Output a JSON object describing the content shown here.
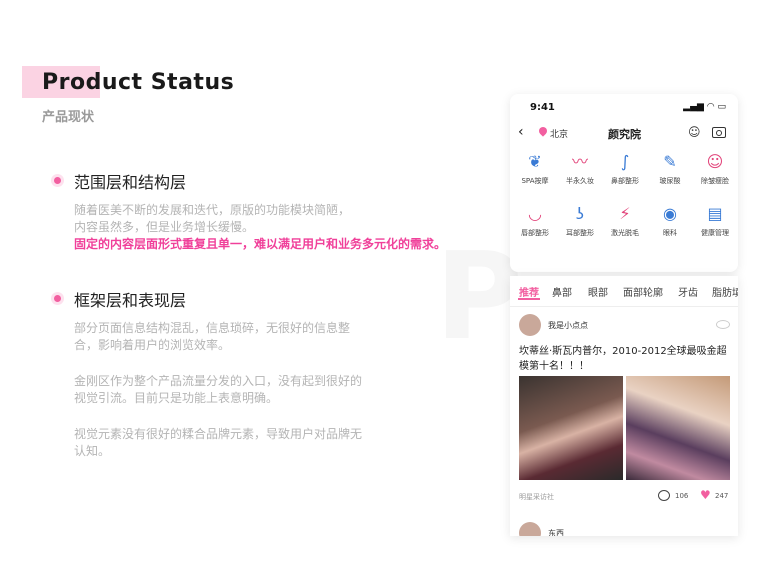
{
  "header": {
    "title": "Product Status",
    "subtitle": "产品现状"
  },
  "watermark": "P",
  "sections": [
    {
      "title": "范围层和结构层",
      "paragraphs": [
        {
          "lines": [
            "随着医美不断的发展和迭代，原版的功能模块简陋，",
            "内容虽然多，但是业务增长缓慢。"
          ]
        },
        {
          "lines": [
            "固定的内容层面形式重复且单一，难以满足用户和业务多元化的需求。"
          ],
          "highlight": true
        }
      ]
    },
    {
      "title": "框架层和表现层",
      "paragraphs": [
        {
          "lines": [
            "部分页面信息结构混乱，信息琐碎，无很好的信息整",
            "合，影响着用户的浏览效率。"
          ]
        },
        {
          "lines": [
            "金刚区作为整个产品流量分发的入口，没有起到很好的",
            "视觉引流。目前只是功能上表意明确。"
          ]
        },
        {
          "lines": [
            "视觉元素没有很好的糅合品牌元素，导致用户对品牌无",
            "认知。"
          ]
        }
      ]
    }
  ],
  "phone": {
    "status_time": "9:41",
    "status_icons": "▂▄▆ ◠ ▭",
    "nav": {
      "back_icon": "‹",
      "location": "北京",
      "title": "颜究院"
    },
    "grid": [
      {
        "icon": "spa-icon",
        "glyph": "❦",
        "label": "SPA按摩",
        "color": "#3a7bd5"
      },
      {
        "icon": "eyebrow-icon",
        "glyph": "〰",
        "label": "半永久妆",
        "color": "#e2457b"
      },
      {
        "icon": "nose-icon",
        "glyph": "∫",
        "label": "鼻部整形",
        "color": "#3a7bd5"
      },
      {
        "icon": "syringe-icon",
        "glyph": "✎",
        "label": "玻尿酸",
        "color": "#3a7bd5"
      },
      {
        "icon": "face-icon",
        "glyph": "☺",
        "label": "除皱瘦脸",
        "color": "#e2457b"
      },
      {
        "icon": "lips-icon",
        "glyph": "◡",
        "label": "唇部整形",
        "color": "#e2457b"
      },
      {
        "icon": "ear-icon",
        "glyph": "ʖ",
        "label": "耳部整形",
        "color": "#3a7bd5"
      },
      {
        "icon": "laser-icon",
        "glyph": "⚡",
        "label": "激光脱毛",
        "color": "#e2457b"
      },
      {
        "icon": "eye-icon",
        "glyph": "◉",
        "label": "眼科",
        "color": "#3a7bd5"
      },
      {
        "icon": "clipboard-icon",
        "glyph": "▤",
        "label": "健康管理",
        "color": "#3a7bd5"
      }
    ],
    "tabs": [
      "推荐",
      "鼻部",
      "眼部",
      "面部轮廓",
      "牙齿",
      "脂肪填"
    ],
    "post": {
      "author": "我是小点点",
      "text": "坎蒂丝·斯瓦内普尔，2010-2012全球最吸金超模第十名！！！",
      "source": "明星采访社",
      "comments": "106",
      "likes": "247"
    },
    "next_author": "东西"
  },
  "colors": {
    "accent": "#f25fa0",
    "highlight": "#f0409a",
    "muted": "#b4b4b4"
  }
}
